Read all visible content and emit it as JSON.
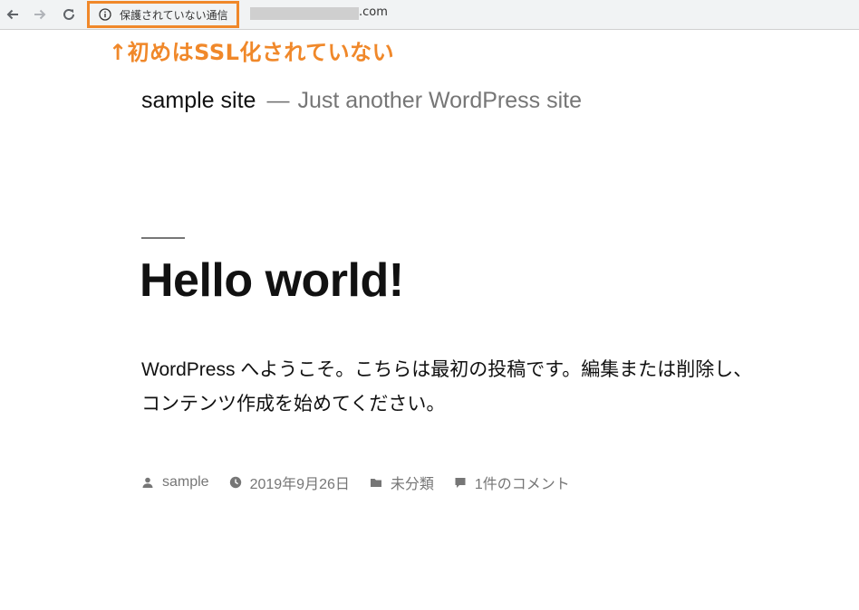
{
  "browser": {
    "security_label": "保護されていない通信",
    "url_visible": ".com",
    "icons": {
      "back": "back-arrow-icon",
      "forward": "forward-arrow-icon",
      "reload": "reload-icon",
      "info": "info-icon"
    }
  },
  "annotation": {
    "text": "↑初めはSSL化されていない",
    "color": "#f0882a"
  },
  "site": {
    "title": "sample site",
    "separator": "—",
    "description": "Just another WordPress site"
  },
  "post": {
    "title": "Hello world!",
    "body": "WordPress へようこそ。こちらは最初の投稿です。編集または削除し、コンテンツ作成を始めてください。",
    "meta": {
      "author": "sample",
      "date": "2019年9月26日",
      "category": "未分類",
      "comments": "1件のコメント"
    }
  }
}
